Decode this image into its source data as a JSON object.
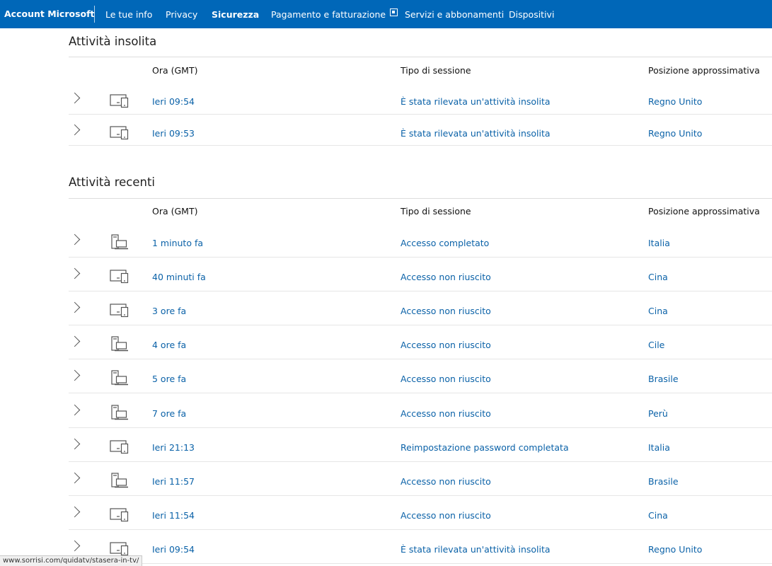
{
  "header": {
    "brand": "Account Microsoft",
    "nav": [
      {
        "label": "Le tue info"
      },
      {
        "label": "Privacy"
      },
      {
        "label": "Sicurezza",
        "active": true
      },
      {
        "label": "Pagamento e fatturazione"
      },
      {
        "label": "Servizi e abbonamenti"
      },
      {
        "label": "Dispositivi"
      }
    ]
  },
  "columns": {
    "time": "Ora (GMT)",
    "session": "Tipo di sessione",
    "location": "Posizione approssimativa"
  },
  "unusual": {
    "title": "Attività insolita",
    "rows": [
      {
        "device": "tablet-phone-icon",
        "time": "Ieri 09:54",
        "session": "È stata rilevata un'attività insolita",
        "location": "Regno Unito"
      },
      {
        "device": "tablet-phone-icon",
        "time": "Ieri 09:53",
        "session": "È stata rilevata un'attività insolita",
        "location": "Regno Unito"
      }
    ]
  },
  "recent": {
    "title": "Attività recenti",
    "rows": [
      {
        "device": "desktop-laptop-icon",
        "time": "1 minuto fa",
        "session": "Accesso completato",
        "location": "Italia"
      },
      {
        "device": "tablet-phone-icon",
        "time": "40 minuti fa",
        "session": "Accesso non riuscito",
        "location": "Cina"
      },
      {
        "device": "tablet-phone-icon",
        "time": "3 ore fa",
        "session": "Accesso non riuscito",
        "location": "Cina"
      },
      {
        "device": "desktop-laptop-icon",
        "time": "4 ore fa",
        "session": "Accesso non riuscito",
        "location": "Cile"
      },
      {
        "device": "desktop-laptop-icon",
        "time": "5 ore fa",
        "session": "Accesso non riuscito",
        "location": "Brasile"
      },
      {
        "device": "desktop-laptop-icon",
        "time": "7 ore fa",
        "session": "Accesso non riuscito",
        "location": "Perù"
      },
      {
        "device": "tablet-phone-icon",
        "time": "Ieri 21:13",
        "session": "Reimpostazione password completata",
        "location": "Italia"
      },
      {
        "device": "desktop-laptop-icon",
        "time": "Ieri 11:57",
        "session": "Accesso non riuscito",
        "location": "Brasile"
      },
      {
        "device": "tablet-phone-icon",
        "time": "Ieri 11:54",
        "session": "Accesso non riuscito",
        "location": "Cina"
      },
      {
        "device": "tablet-phone-icon",
        "time": "Ieri 09:54",
        "session": "È stata rilevata un'attività insolita",
        "location": "Regno Unito"
      }
    ]
  },
  "status_url": "www.sorrisi.com/quidatv/stasera-in-tv/",
  "colors": {
    "accent": "#0067b8",
    "link": "#0b62a8"
  }
}
